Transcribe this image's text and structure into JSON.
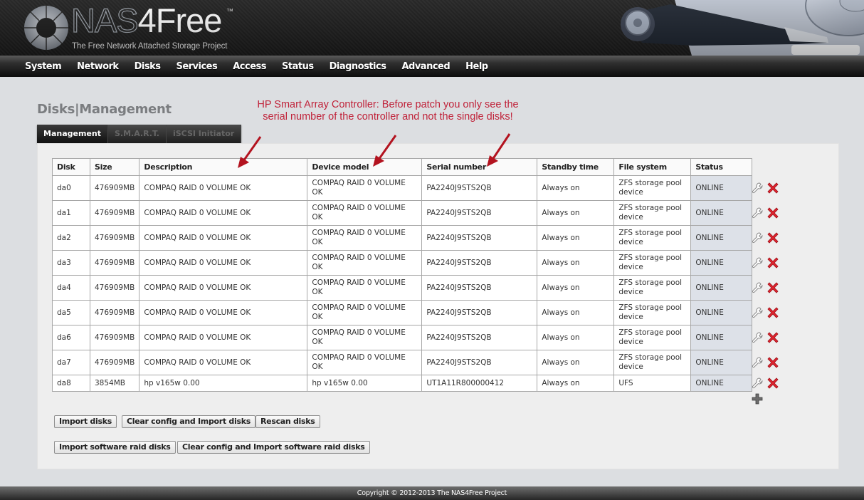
{
  "header": {
    "logo_nas": "NAS",
    "logo_4free": "4Free",
    "trademark": "™",
    "tagline": "The Free Network Attached Storage Project"
  },
  "nav": {
    "items": [
      {
        "label": "System"
      },
      {
        "label": "Network"
      },
      {
        "label": "Disks"
      },
      {
        "label": "Services"
      },
      {
        "label": "Access"
      },
      {
        "label": "Status"
      },
      {
        "label": "Diagnostics"
      },
      {
        "label": "Advanced"
      },
      {
        "label": "Help"
      }
    ]
  },
  "page": {
    "title": "Disks|Management"
  },
  "annotation": {
    "line1": "HP Smart Array Controller: Before patch you only see the",
    "line2": "serial number of the controller and not the single disks!",
    "color": "#c0233a"
  },
  "tabs": [
    {
      "label": "Management",
      "active": true
    },
    {
      "label": "S.M.A.R.T.",
      "active": false
    },
    {
      "label": "iSCSI Initiator",
      "active": false
    }
  ],
  "table": {
    "columns": [
      "Disk",
      "Size",
      "Description",
      "Device model",
      "Serial number",
      "Standby time",
      "File system",
      "Status"
    ],
    "rows": [
      {
        "disk": "da0",
        "size": "476909MB",
        "description": "COMPAQ RAID 0 VOLUME OK",
        "model": "COMPAQ RAID 0 VOLUME OK",
        "serial": "PA2240J9STS2QB",
        "standby": "Always on",
        "fs": "ZFS storage pool device",
        "status": "ONLINE"
      },
      {
        "disk": "da1",
        "size": "476909MB",
        "description": "COMPAQ RAID 0 VOLUME OK",
        "model": "COMPAQ RAID 0 VOLUME OK",
        "serial": "PA2240J9STS2QB",
        "standby": "Always on",
        "fs": "ZFS storage pool device",
        "status": "ONLINE"
      },
      {
        "disk": "da2",
        "size": "476909MB",
        "description": "COMPAQ RAID 0 VOLUME OK",
        "model": "COMPAQ RAID 0 VOLUME OK",
        "serial": "PA2240J9STS2QB",
        "standby": "Always on",
        "fs": "ZFS storage pool device",
        "status": "ONLINE"
      },
      {
        "disk": "da3",
        "size": "476909MB",
        "description": "COMPAQ RAID 0 VOLUME OK",
        "model": "COMPAQ RAID 0 VOLUME OK",
        "serial": "PA2240J9STS2QB",
        "standby": "Always on",
        "fs": "ZFS storage pool device",
        "status": "ONLINE"
      },
      {
        "disk": "da4",
        "size": "476909MB",
        "description": "COMPAQ RAID 0 VOLUME OK",
        "model": "COMPAQ RAID 0 VOLUME OK",
        "serial": "PA2240J9STS2QB",
        "standby": "Always on",
        "fs": "ZFS storage pool device",
        "status": "ONLINE"
      },
      {
        "disk": "da5",
        "size": "476909MB",
        "description": "COMPAQ RAID 0 VOLUME OK",
        "model": "COMPAQ RAID 0 VOLUME OK",
        "serial": "PA2240J9STS2QB",
        "standby": "Always on",
        "fs": "ZFS storage pool device",
        "status": "ONLINE"
      },
      {
        "disk": "da6",
        "size": "476909MB",
        "description": "COMPAQ RAID 0 VOLUME OK",
        "model": "COMPAQ RAID 0 VOLUME OK",
        "serial": "PA2240J9STS2QB",
        "standby": "Always on",
        "fs": "ZFS storage pool device",
        "status": "ONLINE"
      },
      {
        "disk": "da7",
        "size": "476909MB",
        "description": "COMPAQ RAID 0 VOLUME OK",
        "model": "COMPAQ RAID 0 VOLUME OK",
        "serial": "PA2240J9STS2QB",
        "standby": "Always on",
        "fs": "ZFS storage pool device",
        "status": "ONLINE"
      },
      {
        "disk": "da8",
        "size": "3854MB",
        "description": "hp v165w 0.00",
        "model": "hp v165w 0.00",
        "serial": "UT1A11R800000412",
        "standby": "Always on",
        "fs": "UFS",
        "status": "ONLINE"
      }
    ],
    "row_actions": [
      "edit-icon (wrench)",
      "delete-icon (red x)"
    ],
    "add_action": "add-icon (plus)"
  },
  "buttons": {
    "import_disks": "Import disks",
    "clear_import_disks": "Clear config and Import disks",
    "rescan_disks": "Rescan disks",
    "import_raid": "Import software raid disks",
    "clear_import_raid": "Clear config and Import software raid disks"
  },
  "footer": {
    "copyright": "Copyright © 2012-2013 The NAS4Free Project"
  }
}
